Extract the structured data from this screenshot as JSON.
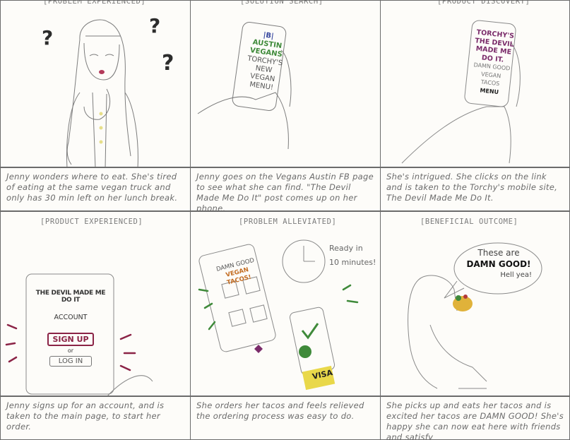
{
  "panels": [
    {
      "tag": "[PROBLEM EXPERIENCED]",
      "caption": "Jenny wonders where to eat. She's tired of eating at the same vegan truck and only has 30 min left on her lunch break."
    },
    {
      "tag": "[SOLUTION SEARCH]",
      "caption": "Jenny goes on the Vegans Austin FB page to see what she can find. \"The Devil Made Me Do It\" post comes up on her phone.",
      "phone_lines": [
        "|B|",
        "AUSTIN",
        "VEGANS",
        "TORCHY'S",
        "NEW",
        "VEGAN",
        "MENU!"
      ]
    },
    {
      "tag": "[PRODUCT DISCOVERY]",
      "caption": "She's intrigued. She clicks on the link and is taken to the Torchy's mobile site, The Devil Made Me Do It.",
      "phone_lines": [
        "TORCHY'S",
        "THE DEVIL",
        "MADE ME",
        "DO IT.",
        "DAMN GOOD",
        "VEGAN TACOS",
        "MENU"
      ]
    },
    {
      "tag": "[PRODUCT EXPERIENCED]",
      "caption": "Jenny signs up for an account, and is taken to the main page, to start her order.",
      "tablet": {
        "title": "THE DEVIL MADE ME DO IT",
        "account": "ACCOUNT",
        "signup": "SIGN UP",
        "or": "or",
        "login": "LOG IN"
      }
    },
    {
      "tag": "[PROBLEM ALLEVIATED]",
      "caption": "She orders her tacos and feels relieved the ordering process was easy to do.",
      "phone_lines": [
        "DAMN GOOD",
        "VEGAN TACOS!"
      ],
      "ready": [
        "Ready in",
        "10 minutes!"
      ],
      "card": "VISA"
    },
    {
      "tag": "[BENEFICIAL OUTCOME]",
      "caption": "She picks up and eats her tacos and is excited her tacos are DAMN GOOD! She's happy she can now eat here with friends and satisfy",
      "bubble": [
        "These are",
        "DAMN GOOD!",
        "Hell yea!"
      ]
    }
  ],
  "colors": {
    "ink": "#6b6b6b",
    "purple": "#7a2b6a",
    "maroon": "#8b2346",
    "green": "#3f8a3a",
    "orange": "#c26a1f",
    "yellow": "#e9d84a"
  }
}
